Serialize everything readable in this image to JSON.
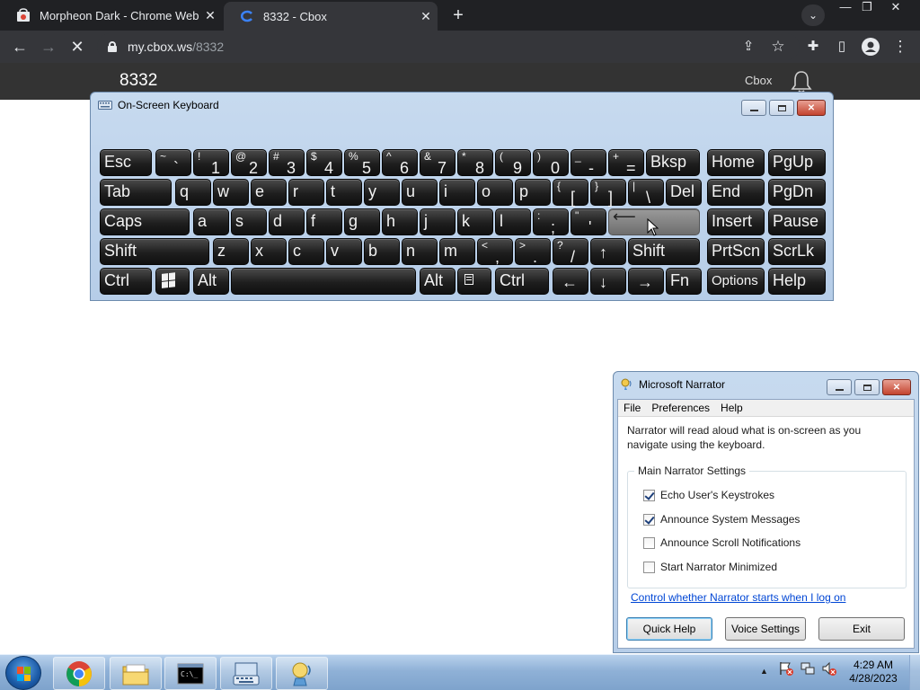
{
  "browser": {
    "tabs": [
      {
        "title": "Morpheon Dark - Chrome Web S",
        "close": "✕",
        "icon": "chrome-web-store-icon"
      },
      {
        "title": "8332 - Cbox",
        "close": "✕",
        "icon": "cbox-icon"
      }
    ],
    "new_tab": "+",
    "tab_menu": "⌄",
    "window_controls": {
      "minimize": "—",
      "restore": "❐",
      "close": "✕"
    },
    "url_host": "my.cbox.ws",
    "url_path": "/8332",
    "nav": {
      "back": "←",
      "forward": "→",
      "stop": "✕"
    },
    "toolbar_icons": {
      "share": "⇪",
      "star": "☆",
      "extensions": "✚",
      "sidebar": "▯",
      "menu": "⋮"
    }
  },
  "page": {
    "room_name": "8332",
    "brand": "Cbox"
  },
  "osk": {
    "title": "On-Screen Keyboard",
    "rows": [
      [
        {
          "main": "Esc"
        },
        {
          "shift": "~",
          "low": "`"
        },
        {
          "shift": "!",
          "low": "1"
        },
        {
          "shift": "@",
          "low": "2"
        },
        {
          "shift": "#",
          "low": "3"
        },
        {
          "shift": "$",
          "low": "4"
        },
        {
          "shift": "%",
          "low": "5"
        },
        {
          "shift": "^",
          "low": "6"
        },
        {
          "shift": "&",
          "low": "7"
        },
        {
          "shift": "*",
          "low": "8"
        },
        {
          "shift": "(",
          "low": "9"
        },
        {
          "shift": ")",
          "low": "0"
        },
        {
          "shift": "_",
          "low": "-"
        },
        {
          "shift": "+",
          "low": "="
        },
        {
          "main": "Bksp"
        },
        {
          "main": "Home"
        },
        {
          "main": "PgUp"
        }
      ],
      [
        {
          "main": "Tab"
        },
        {
          "main": "q"
        },
        {
          "main": "w"
        },
        {
          "main": "e"
        },
        {
          "main": "r"
        },
        {
          "main": "t"
        },
        {
          "main": "y"
        },
        {
          "main": "u"
        },
        {
          "main": "i"
        },
        {
          "main": "o"
        },
        {
          "main": "p"
        },
        {
          "shift": "{",
          "low": "["
        },
        {
          "shift": "}",
          "low": "]"
        },
        {
          "shift": "|",
          "low": "\\"
        },
        {
          "main": "Del"
        },
        {
          "main": "End"
        },
        {
          "main": "PgDn"
        }
      ],
      [
        {
          "main": "Caps"
        },
        {
          "main": "a"
        },
        {
          "main": "s"
        },
        {
          "main": "d"
        },
        {
          "main": "f"
        },
        {
          "main": "g"
        },
        {
          "main": "h"
        },
        {
          "main": "j"
        },
        {
          "main": "k"
        },
        {
          "main": "l"
        },
        {
          "shift": ":",
          "low": ";"
        },
        {
          "shift": "\"",
          "low": "'"
        },
        {
          "main": "⟵",
          "active": true
        },
        {
          "main": "Insert"
        },
        {
          "main": "Pause"
        }
      ],
      [
        {
          "main": "Shift"
        },
        {
          "main": "z"
        },
        {
          "main": "x"
        },
        {
          "main": "c"
        },
        {
          "main": "v"
        },
        {
          "main": "b"
        },
        {
          "main": "n"
        },
        {
          "main": "m"
        },
        {
          "shift": "<",
          "low": ","
        },
        {
          "shift": ">",
          "low": "."
        },
        {
          "shift": "?",
          "low": "/"
        },
        {
          "shift": "↑",
          "low": ""
        },
        {
          "main": "Shift"
        },
        {
          "main": "PrtScn"
        },
        {
          "main": "ScrLk"
        }
      ],
      [
        {
          "main": "Ctrl"
        },
        {
          "icon": "windows-key"
        },
        {
          "main": "Alt"
        },
        {
          "main": ""
        },
        {
          "main": "Alt"
        },
        {
          "icon": "menu-key"
        },
        {
          "main": "Ctrl"
        },
        {
          "shift": "←",
          "low": ""
        },
        {
          "shift": "↓",
          "low": ""
        },
        {
          "shift": "→",
          "low": ""
        },
        {
          "main": "Fn"
        },
        {
          "main": "Options",
          "small": true
        },
        {
          "main": "Help"
        }
      ]
    ]
  },
  "narrator": {
    "title": "Microsoft Narrator",
    "menu": [
      "File",
      "Preferences",
      "Help"
    ],
    "description": "Narrator will read aloud what is on-screen as you navigate using the keyboard.",
    "group_label": "Main Narrator Settings",
    "options": [
      {
        "label": "Echo User's Keystrokes",
        "checked": true
      },
      {
        "label": "Announce System Messages",
        "checked": true
      },
      {
        "label": "Announce Scroll Notifications",
        "checked": false
      },
      {
        "label": "Start Narrator Minimized",
        "checked": false
      }
    ],
    "link": "Control whether Narrator starts when I log on",
    "buttons": {
      "quick_help": "Quick Help",
      "voice_settings": "Voice Settings",
      "exit": "Exit"
    }
  },
  "taskbar": {
    "pinned": [
      "chrome-icon",
      "explorer-icon",
      "cmd-icon",
      "on-screen-keyboard-icon",
      "narrator-icon"
    ],
    "tray_arrow": "▲",
    "time": "4:29 AM",
    "date": "4/28/2023"
  }
}
